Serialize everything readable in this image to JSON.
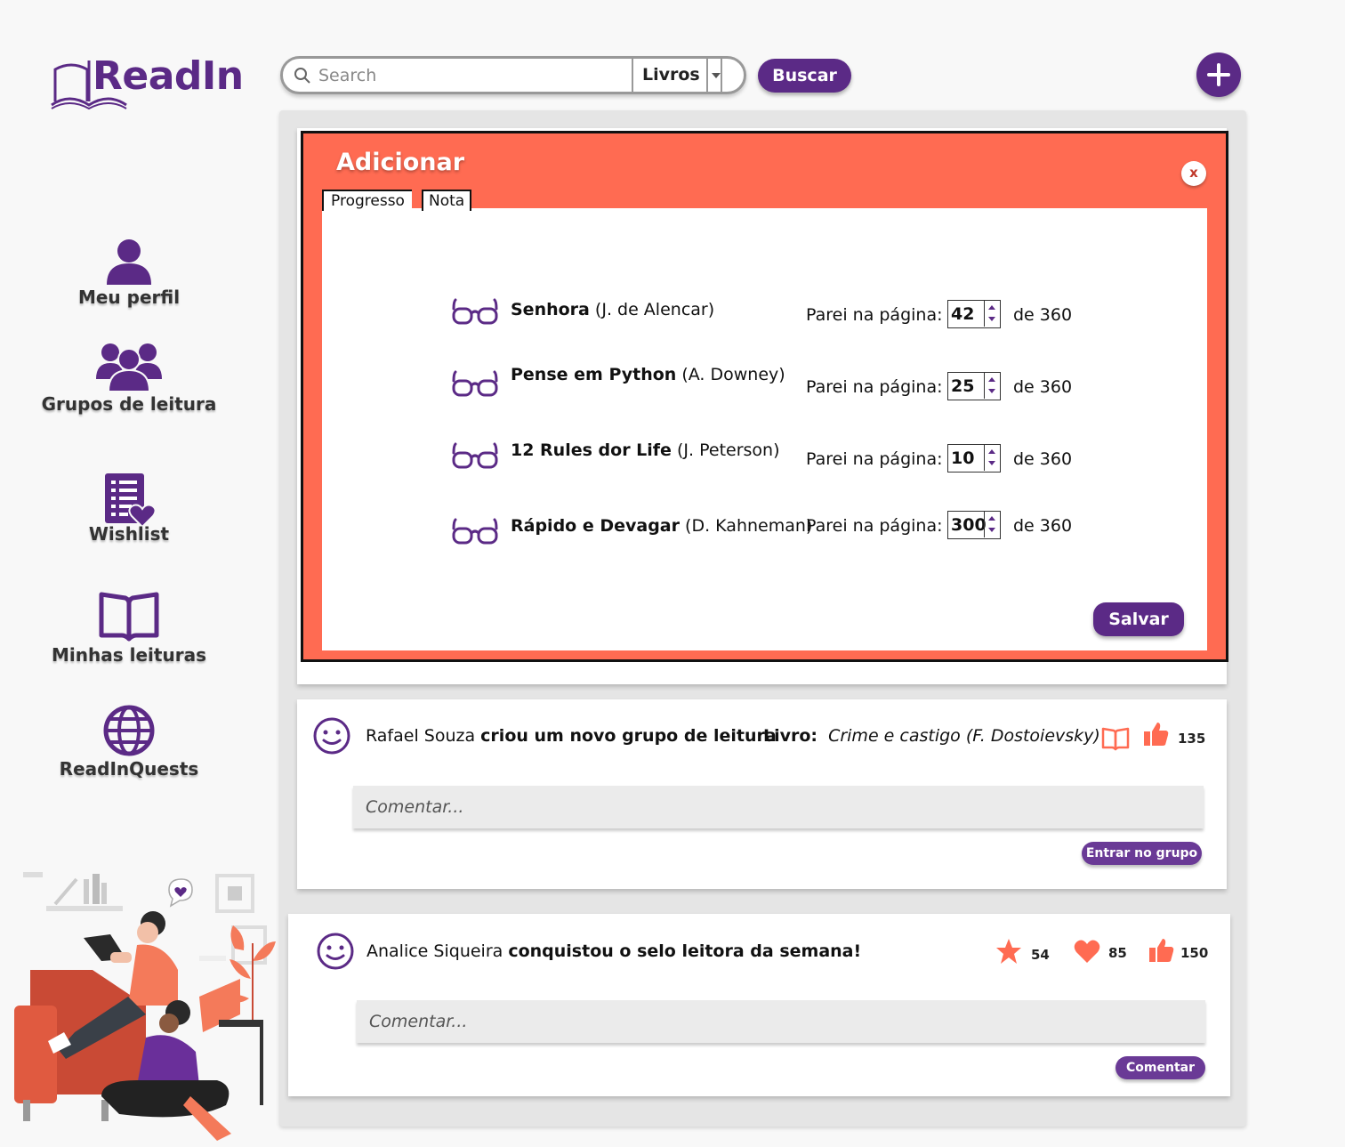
{
  "app": {
    "logo_text": "ReadIn"
  },
  "colors": {
    "brand": "#5b2a86",
    "accent": "#ff6b52",
    "feed_bg": "#e5e5e5"
  },
  "sidebar": {
    "items": [
      {
        "label": "Meu perfil",
        "icon": "user-icon"
      },
      {
        "label": "Grupos de leitura",
        "icon": "group-icon"
      },
      {
        "label": "Wishlist",
        "icon": "wishlist-icon"
      },
      {
        "label": "Minhas leituras",
        "icon": "open-book-icon"
      },
      {
        "label": "ReadInQuests",
        "icon": "globe-icon"
      }
    ]
  },
  "search": {
    "placeholder": "Search",
    "value": "",
    "category": "Livros",
    "button_label": "Buscar"
  },
  "modal": {
    "title": "Adicionar",
    "close_label": "x",
    "tabs": [
      "Progresso",
      "Nota"
    ],
    "save_label": "Salvar",
    "books": [
      {
        "title": "Senhora",
        "author": "(J. de Alencar)",
        "page_label": "Parei na página:",
        "page": "42",
        "total": "de 360"
      },
      {
        "title": "Pense em Python",
        "author": "(A. Downey)",
        "page_label": "Parei na página:",
        "page": "25",
        "total": "de 360"
      },
      {
        "title": "12 Rules dor Life",
        "author": "(J. Peterson)",
        "page_label": "Parei na página:",
        "page": "10",
        "total": "de 360"
      },
      {
        "title": "Rápido e Devagar",
        "author": "(D. Kahneman)",
        "page_label": "Parei na página:",
        "page": "300",
        "total": "de 360"
      }
    ]
  },
  "posts": [
    {
      "user": "Rafael Souza",
      "action": "criou um novo grupo de leitura",
      "book_label": "Livro:",
      "book": "Crime e castigo (F. Dostoievsky)",
      "likes": "135",
      "comment_placeholder": "Comentar...",
      "button_label": "Entrar no grupo"
    },
    {
      "user": "Analice Siqueira",
      "action": "conquistou o selo leitora da semana!",
      "stars": "54",
      "hearts": "85",
      "likes": "150",
      "comment_placeholder": "Comentar...",
      "button_label": "Comentar"
    }
  ]
}
